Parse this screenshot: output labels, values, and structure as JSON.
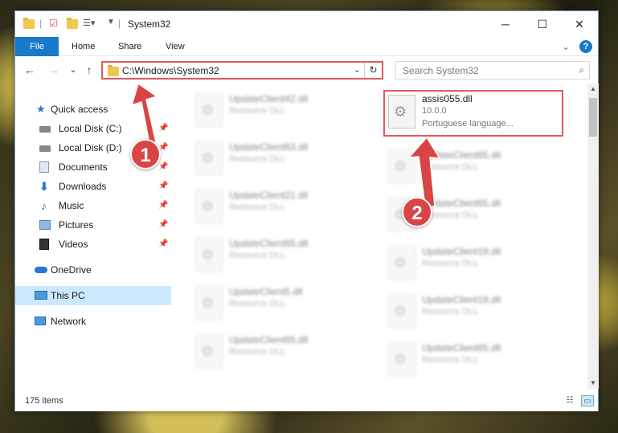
{
  "window": {
    "title": "System32",
    "minimize": "─",
    "maximize": "☐",
    "close": "✕"
  },
  "ribbon": {
    "tabs": [
      "File",
      "Home",
      "Share",
      "View"
    ],
    "collapse": "⌄",
    "help": "?"
  },
  "navbar": {
    "back": "←",
    "forward": "→",
    "recent": "⌄",
    "up": "↑",
    "address": "C:\\Windows\\System32",
    "address_chevron": "⌄",
    "refresh": "↻",
    "search_placeholder": "Search System32",
    "search_icon": "⌕"
  },
  "nav_pane": {
    "items": [
      {
        "label": "Quick access",
        "icon": "star-icon"
      },
      {
        "label": "Local Disk (C:)",
        "icon": "drive-icon",
        "pinned": true
      },
      {
        "label": "Local Disk (D:)",
        "icon": "drive-icon",
        "pinned": true
      },
      {
        "label": "Documents",
        "icon": "documents-icon",
        "pinned": true
      },
      {
        "label": "Downloads",
        "icon": "downloads-icon",
        "pinned": true
      },
      {
        "label": "Music",
        "icon": "music-icon",
        "pinned": true
      },
      {
        "label": "Pictures",
        "icon": "pictures-icon",
        "pinned": true
      },
      {
        "label": "Videos",
        "icon": "videos-icon",
        "pinned": true
      },
      {
        "label": "OneDrive",
        "icon": "cloud-icon"
      },
      {
        "label": "This PC",
        "icon": "computer-icon",
        "selected": true
      },
      {
        "label": "Network",
        "icon": "network-icon"
      }
    ],
    "pin_glyph": "📌"
  },
  "files": {
    "highlighted": {
      "name": "assis055.dll",
      "version": "10.0.0",
      "description": "Portuguese language..."
    },
    "left_column": [
      {
        "name": "UpdateClient42.dll",
        "desc": "Resource DLL"
      },
      {
        "name": "UpdateClient63.dll",
        "desc": "Resource DLL"
      },
      {
        "name": "UpdateClient21.dll",
        "desc": "Resource DLL"
      },
      {
        "name": "UpdateClient65.dll",
        "desc": "Resource DLL"
      },
      {
        "name": "UpdateClient5.dll",
        "desc": "Resource DLL"
      },
      {
        "name": "UpdateClient65.dll",
        "desc": "Resource DLL"
      }
    ],
    "right_column": [
      {
        "name": "UpdateClient65.dll",
        "desc": "Resource DLL"
      },
      {
        "name": "UpdateClient65.dll",
        "desc": "Resource DLL"
      },
      {
        "name": "UpdateClient19.dll",
        "desc": "Resource DLL"
      },
      {
        "name": "UpdateClient19.dll",
        "desc": "Resource DLL"
      },
      {
        "name": "UpdateClient65.dll",
        "desc": "Resource DLL"
      }
    ]
  },
  "status": {
    "count": "175 items"
  },
  "callouts": [
    "1",
    "2"
  ],
  "colors": {
    "accent": "#1979ca",
    "highlight": "#e05a5a",
    "selected": "#cce8ff"
  }
}
